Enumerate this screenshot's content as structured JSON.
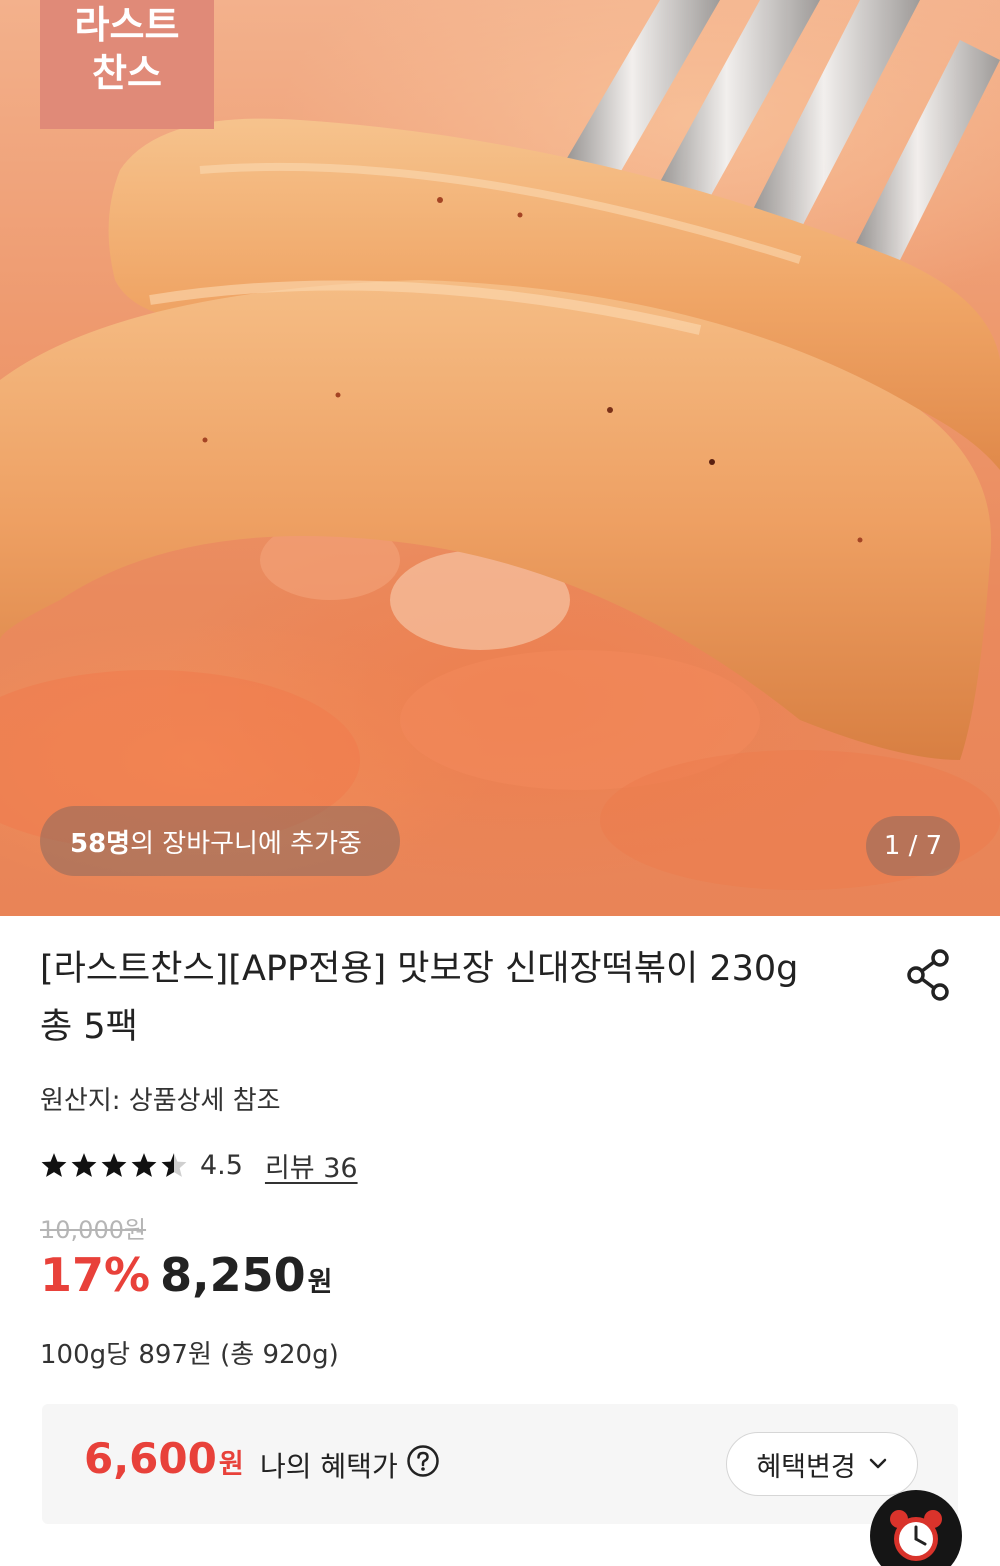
{
  "hero": {
    "badge_line1": "라스트",
    "badge_line2": "찬스",
    "cart_count": "58명",
    "cart_text": "의 장바구니에 추가중",
    "page_indicator": "1 / 7"
  },
  "product": {
    "title": "[라스트찬스][APP전용] 맛보장 신대장떡볶이 230g 총 5팩",
    "origin": "원산지: 상품상세 참조",
    "rating": 4.5,
    "rating_text": "4.5",
    "review_link": "리뷰 36",
    "original_price": "10,000원",
    "discount": "17%",
    "sale_price": "8,250",
    "sale_price_unit": "원",
    "unit_price": "100g당 897원 (총 920g)"
  },
  "benefit": {
    "price": "6,600",
    "price_unit": "원",
    "label": "나의 혜택가",
    "change_button": "혜택변경"
  },
  "icons": {
    "share": "share-icon",
    "help": "question-circle-icon",
    "chevron": "chevron-down-icon",
    "clock": "alarm-clock-icon"
  },
  "colors": {
    "accent_red": "#e8413a",
    "badge_bg": "#e08a78"
  }
}
